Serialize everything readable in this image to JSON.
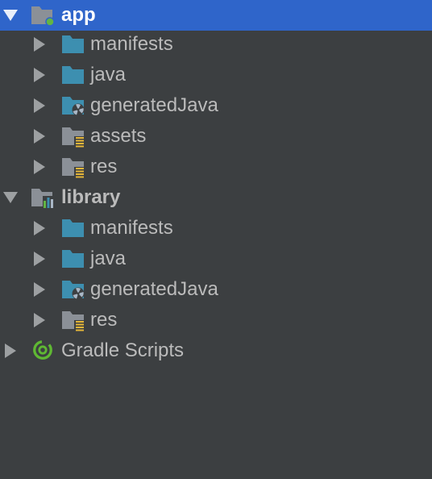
{
  "tree": {
    "items": [
      {
        "label": "app",
        "icon": "module-app-folder-icon",
        "expanded": true,
        "selected": true
      },
      {
        "label": "manifests",
        "icon": "source-folder-icon"
      },
      {
        "label": "java",
        "icon": "source-folder-icon"
      },
      {
        "label": "generatedJava",
        "icon": "generated-source-folder-icon"
      },
      {
        "label": "assets",
        "icon": "resource-folder-icon"
      },
      {
        "label": "res",
        "icon": "resource-folder-icon"
      },
      {
        "label": "library",
        "icon": "module-library-folder-icon",
        "expanded": true
      },
      {
        "label": "manifests",
        "icon": "source-folder-icon"
      },
      {
        "label": "java",
        "icon": "source-folder-icon"
      },
      {
        "label": "generatedJava",
        "icon": "generated-source-folder-icon"
      },
      {
        "label": "res",
        "icon": "resource-folder-icon"
      },
      {
        "label": "Gradle Scripts",
        "icon": "gradle-icon"
      }
    ]
  },
  "colors": {
    "background": "#3c3f41",
    "selection": "#2f65ca",
    "text": "#bbbbbb",
    "folder_blue": "#3d8fb0",
    "folder_gray": "#8b9097",
    "resource_stripes": "#e5b639",
    "app_dot": "#62b543",
    "gradle_green": "#5fb833"
  }
}
